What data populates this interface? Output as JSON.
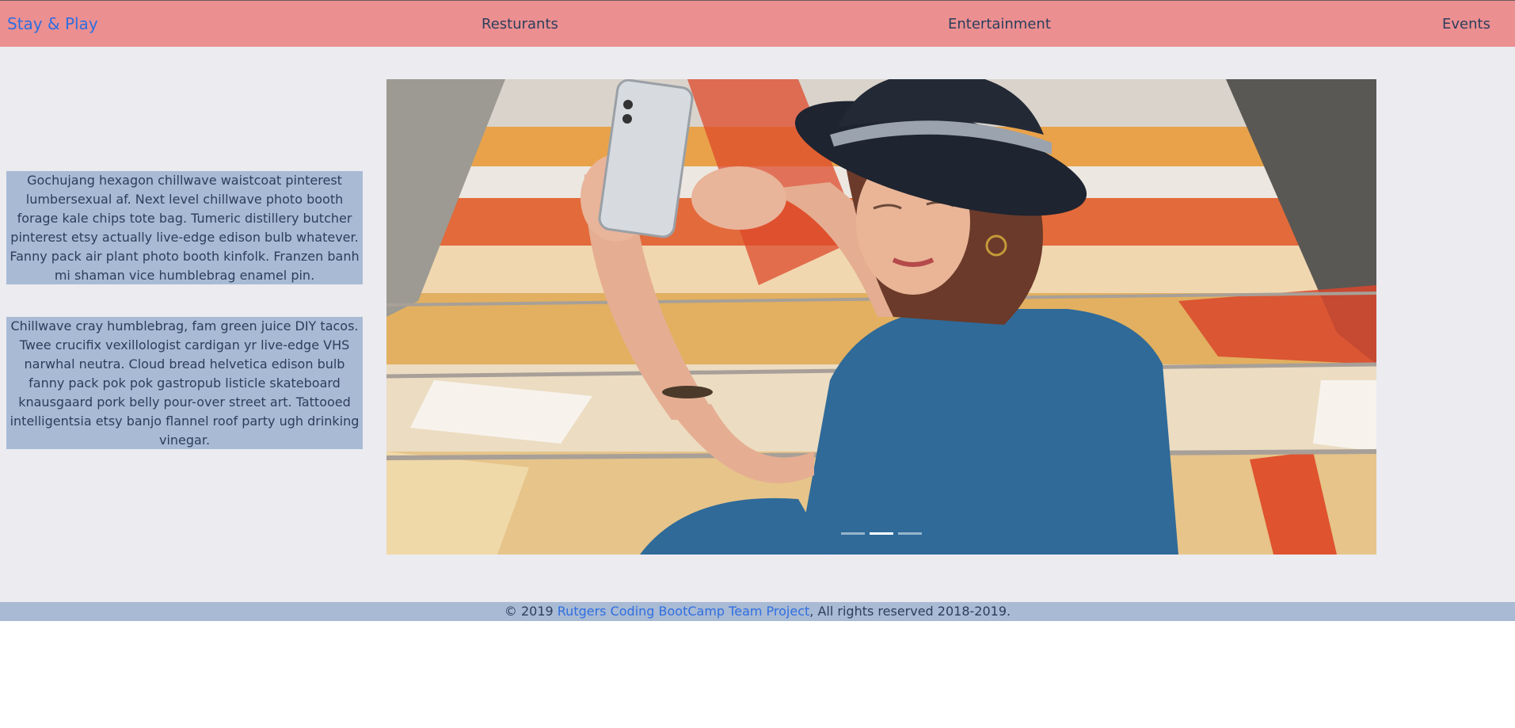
{
  "nav": {
    "brand": "Stay & Play",
    "links": [
      "Resturants",
      "Entertainment",
      "Events"
    ]
  },
  "sidebar": {
    "paragraphs": [
      "Gochujang hexagon chillwave waistcoat pinterest lumbersexual af. Next level chillwave photo booth forage kale chips tote bag. Tumeric distillery butcher pinterest etsy actually live-edge edison bulb whatever. Fanny pack air plant photo booth kinfolk. Franzen banh mi shaman vice humblebrag enamel pin.",
      "Chillwave cray humblebrag, fam green juice DIY tacos. Twee crucifix vexillologist cardigan yr live-edge VHS narwhal neutra. Cloud bread helvetica edison bulb fanny pack pok pok gastropub listicle skateboard knausgaard pork belly pour-over street art. Tattooed intelligentsia etsy banjo flannel roof party ugh drinking vinegar."
    ]
  },
  "carousel": {
    "slide_count": 3,
    "active_index": 1
  },
  "footer": {
    "prefix": "© 2019 ",
    "link_text": "Rutgers Coding BootCamp Team Project",
    "suffix": ", All rights reserved 2018-2019."
  },
  "colors": {
    "navbar_bg": "#ec8f91",
    "brand": "#2f6fe0",
    "main_bg": "#ebebf0",
    "text_box_bg": "#a9bad4",
    "footer_bg": "#a9bad4",
    "link": "#2f6fe0"
  }
}
